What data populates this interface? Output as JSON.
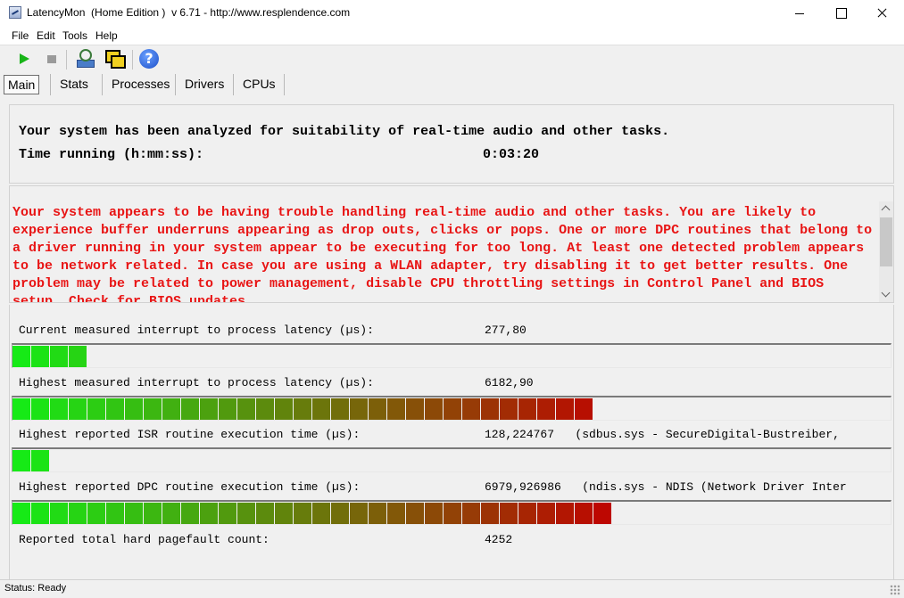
{
  "window": {
    "title": "LatencyMon  (Home Edition )  v 6.71 - http://www.resplendence.com"
  },
  "menu": [
    "File",
    "Edit",
    "Tools",
    "Help"
  ],
  "toolbar": {
    "icons": [
      "start-icon",
      "stop-icon",
      "tool-icon",
      "windows-icon",
      "help-icon"
    ]
  },
  "tabs": [
    "Main",
    "Stats",
    "Processes",
    "Drivers",
    "CPUs"
  ],
  "active_tab": "Main",
  "summary": {
    "line1": "Your system has been analyzed for suitability of real-time audio and other tasks.",
    "time_label": "Time running (h:mm:ss):",
    "time_value": "0:03:20"
  },
  "warning": {
    "text": "Your system appears to be having trouble handling real-time audio and other tasks. You are likely to experience buffer underruns appearing as drop outs, clicks or pops. One or more DPC routines that belong to a driver running in your system appear to be executing for too long. At least one detected problem appears to be network related. In case you are using a WLAN adapter, try disabling it to get better results. One problem may be related to power management, disable CPU throttling settings in Control Panel and BIOS setup. Check for BIOS updates.",
    "color": "#e81515"
  },
  "metrics": [
    {
      "label": "Current measured interrupt to process latency (µs):",
      "value": "277,80",
      "bar_fraction": 0.083
    },
    {
      "label": "Highest measured interrupt to process latency (µs):",
      "value": "6182,90",
      "bar_fraction": 0.658
    },
    {
      "label": "Highest reported ISR routine execution time (µs):",
      "value": "128,224767   (sdbus.sys - SecureDigital-Bustreiber,",
      "bar_fraction": 0.043
    },
    {
      "label": "Highest reported DPC routine execution time (µs):",
      "value": "6979,926986   (ndis.sys - NDIS (Network Driver Inter",
      "bar_fraction": 0.689
    },
    {
      "label": "Reported total hard pagefault count:",
      "value": "4252"
    }
  ],
  "status": {
    "text": "Status: Ready"
  },
  "colors": {
    "bar_start": "#16ea16",
    "bar_end": "#c20000"
  }
}
